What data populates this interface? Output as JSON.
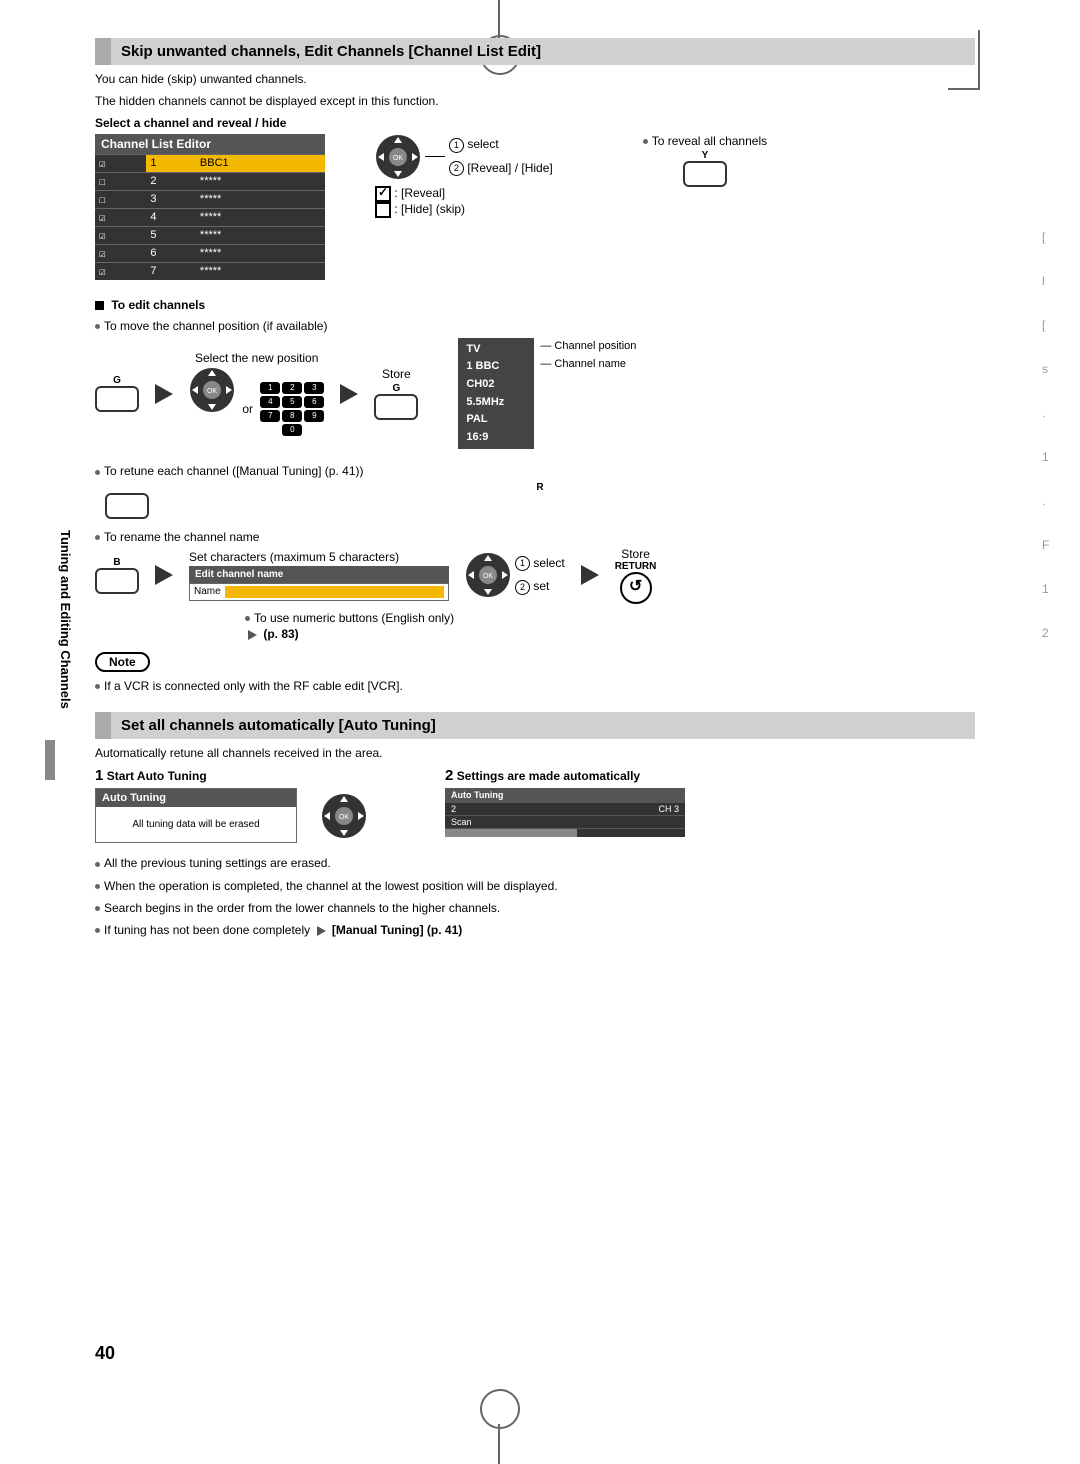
{
  "page_number": "40",
  "side_label": "Tuning and Editing Channels",
  "section1": {
    "title": "Skip unwanted channels, Edit Channels [Channel List Edit]",
    "intro1": "You can hide (skip) unwanted channels.",
    "intro2": "The hidden channels cannot be displayed except in this function.",
    "step_title": "Select a channel and reveal / hide",
    "table_header": "Channel List Editor",
    "rows": [
      {
        "n": "1",
        "name": "BBC1",
        "chk": "☑"
      },
      {
        "n": "2",
        "name": "*****",
        "chk": "☐"
      },
      {
        "n": "3",
        "name": "*****",
        "chk": "☐"
      },
      {
        "n": "4",
        "name": "*****",
        "chk": "☑"
      },
      {
        "n": "5",
        "name": "*****",
        "chk": "☑"
      },
      {
        "n": "6",
        "name": "*****",
        "chk": "☑"
      },
      {
        "n": "7",
        "name": "*****",
        "chk": "☑"
      }
    ],
    "label_select": "select",
    "label_reveal_hide": "[Reveal] / [Hide]",
    "legend_reveal": ": [Reveal]",
    "legend_hide": ": [Hide] (skip)",
    "reveal_all": "To reveal all channels",
    "y_label": "Y"
  },
  "edit": {
    "heading": "To edit channels",
    "move_line": "To move the channel position (if available)",
    "select_pos": "Select the new position",
    "or": "or",
    "store": "Store",
    "g_label": "G",
    "info": {
      "l1": "TV",
      "l2": "1  BBC",
      "l3": "CH02",
      "l4": "5.5MHz",
      "l5": "PAL",
      "l6": "16:9"
    },
    "info_pos": "Channel position",
    "info_name": "Channel name",
    "retune_line": "To retune each channel ([Manual Tuning] (p. 41))",
    "r_label": "R",
    "rename_line": "To rename the channel name",
    "set_chars": "Set characters (maximum 5 characters)",
    "b_label": "B",
    "edit_box_hdr": "Edit channel name",
    "edit_box_field": "Name",
    "label_select": "select",
    "label_set": "set",
    "store2": "Store",
    "return_label": "RETURN",
    "numeric_line": "To use numeric buttons (English only)",
    "numeric_ref": "(p. 83)",
    "note_label": "Note",
    "note_text": "If a VCR is connected only with the RF cable edit [VCR]."
  },
  "section2": {
    "title": "Set all channels automatically [Auto Tuning]",
    "intro": "Automatically retune all channels received in the area.",
    "step1_num": "1",
    "step1_title": "Start Auto Tuning",
    "box1_hdr": "Auto Tuning",
    "box1_body": "All tuning data will be erased",
    "step2_num": "2",
    "step2_title": "Settings are made automatically",
    "box2_hdr": "Auto Tuning",
    "box2_row1a": "2",
    "box2_row1b": "CH 3",
    "box2_row2a": "Scan",
    "bullets": [
      "All the previous tuning settings are erased.",
      "When the operation is completed, the channel at the lowest position will be displayed.",
      "Search begins in the order from the lower channels to the higher channels."
    ],
    "bullet4a": "If tuning has not been done completely",
    "bullet4b": "[Manual Tuning] (p. 41)"
  }
}
